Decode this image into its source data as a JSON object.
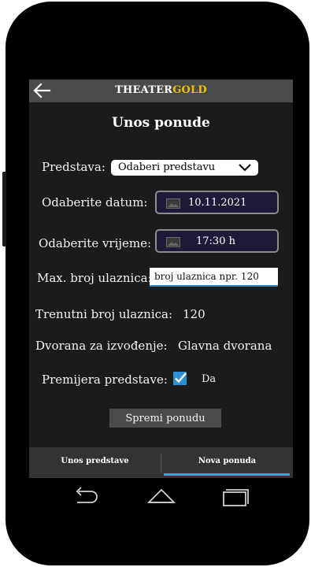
{
  "app": {
    "brand_white": "THEATER",
    "brand_gold": "GOLD",
    "title": "Unos ponude"
  },
  "form": {
    "predstava_label": "Predstava:",
    "predstava_value": "Odaberi predstavu",
    "datum_label": "Odaberite datum:",
    "datum_value": "10.11.2021",
    "vrijeme_label": "Odaberite vrijeme:",
    "vrijeme_value": "17:30 h",
    "max_label": "Max. broj ulaznica:",
    "max_placeholder": "broj ulaznica npr. 120",
    "trenutni_label": "Trenutni broj ulaznica:",
    "trenutni_value": "120",
    "dvorana_label": "Dvorana za izvođenje:",
    "dvorana_value": "Glavna dvorana",
    "premijera_label": "Premijera predstave:",
    "premijera_checked": true,
    "premijera_option": "Da",
    "save_label": "Spremi ponudu"
  },
  "tabs": [
    {
      "label": "Unos predstave",
      "active": false
    },
    {
      "label": "Nova ponuda",
      "active": true
    }
  ],
  "colors": {
    "accent": "#2fa9d8",
    "brand_gold": "#f2c200",
    "checkbox": "#2b8fd6"
  },
  "icons": {
    "back": "arrow-left-icon",
    "dropdown": "chevron-down-icon",
    "picker": "image-icon",
    "check": "checkmark-icon",
    "nav_back": "back-arrow-icon",
    "nav_home": "home-icon",
    "nav_recent": "recent-apps-icon"
  }
}
